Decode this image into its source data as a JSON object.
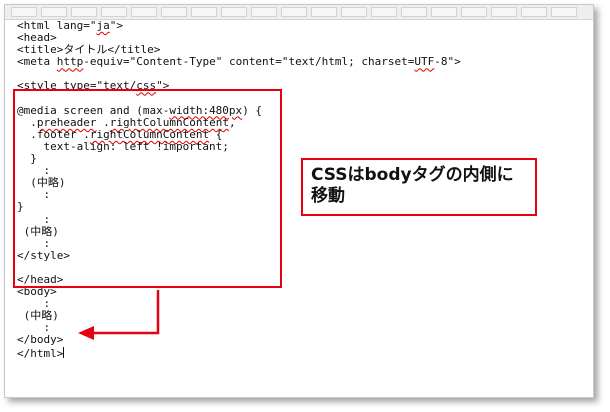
{
  "code_lines": [
    {
      "segments": [
        {
          "t": "<html lang=\""
        },
        {
          "t": "ja",
          "sq": true
        },
        {
          "t": "\">"
        }
      ]
    },
    {
      "segments": [
        {
          "t": "<head>"
        }
      ]
    },
    {
      "segments": [
        {
          "t": "<title>タイトル</title>"
        }
      ]
    },
    {
      "segments": [
        {
          "t": "<meta "
        },
        {
          "t": "http",
          "sq": true
        },
        {
          "t": "-equiv=\"Content-Type\" content=\"text/html; charset="
        },
        {
          "t": "UTF",
          "sq": true
        },
        {
          "t": "-8\">"
        }
      ]
    },
    {
      "segments": [
        {
          "t": ""
        }
      ]
    },
    {
      "segments": [
        {
          "t": "<style type=\"text/"
        },
        {
          "t": "css",
          "sq": true
        },
        {
          "t": "\">"
        }
      ]
    },
    {
      "segments": [
        {
          "t": ""
        }
      ]
    },
    {
      "segments": [
        {
          "t": "@media screen and (max-"
        },
        {
          "t": "width:480px",
          "sq": true
        },
        {
          "t": ") {"
        }
      ]
    },
    {
      "segments": [
        {
          "t": "  ."
        },
        {
          "t": "preheader",
          "sq": true
        },
        {
          "t": " ."
        },
        {
          "t": "rightColumnContent",
          "sq": true
        },
        {
          "t": ","
        }
      ]
    },
    {
      "segments": [
        {
          "t": "  .footer ."
        },
        {
          "t": "rightColumnContent",
          "sq": true
        },
        {
          "t": " {"
        }
      ]
    },
    {
      "segments": [
        {
          "t": "    text-align: left !important;"
        }
      ]
    },
    {
      "segments": [
        {
          "t": "  }"
        }
      ]
    },
    {
      "segments": [
        {
          "t": "    :"
        }
      ]
    },
    {
      "segments": [
        {
          "t": "  (中略)"
        }
      ]
    },
    {
      "segments": [
        {
          "t": "    :"
        }
      ]
    },
    {
      "segments": [
        {
          "t": "}"
        }
      ]
    },
    {
      "segments": [
        {
          "t": "    :"
        }
      ]
    },
    {
      "segments": [
        {
          "t": " (中略)"
        }
      ]
    },
    {
      "segments": [
        {
          "t": "    :"
        }
      ]
    },
    {
      "segments": [
        {
          "t": "</style>"
        }
      ]
    },
    {
      "segments": [
        {
          "t": ""
        }
      ]
    },
    {
      "segments": [
        {
          "t": "</head>"
        }
      ]
    },
    {
      "segments": [
        {
          "t": "<body>"
        }
      ]
    },
    {
      "segments": [
        {
          "t": "    :"
        }
      ]
    },
    {
      "segments": [
        {
          "t": " (中略)"
        }
      ]
    },
    {
      "segments": [
        {
          "t": "    :"
        }
      ]
    },
    {
      "segments": [
        {
          "t": "</body>"
        }
      ]
    },
    {
      "segments": [
        {
          "t": "</html>"
        }
      ],
      "cursor": true
    }
  ],
  "callout": {
    "line1": "CSSはbodyタグの内側に",
    "line2": "移動"
  },
  "colors": {
    "highlight": "#e60012",
    "text": "#111111",
    "squiggle": "#e00000"
  }
}
